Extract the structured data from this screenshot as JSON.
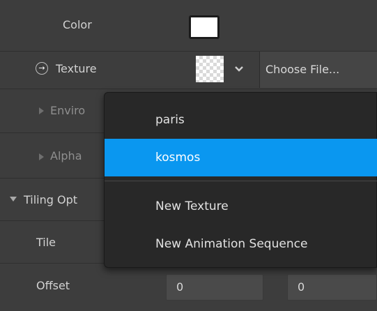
{
  "properties": {
    "color_label": "Color",
    "color_value": "#ffffff",
    "texture_label": "Texture",
    "texture_choose_label": "Choose File...",
    "environment_label": "Enviro",
    "alpha_label": "Alpha",
    "tiling_label": "Tiling Opt",
    "tile_label": "Tile",
    "offset_label": "Offset",
    "offset_x": "0",
    "offset_y": "0"
  },
  "dropdown": {
    "items": [
      {
        "label": "paris",
        "selected": false
      },
      {
        "label": "kosmos",
        "selected": true
      },
      {
        "label": "New Texture",
        "selected": false
      },
      {
        "label": "New Animation Sequence",
        "selected": false
      }
    ]
  },
  "colors": {
    "panel_bg": "#3d3d3d",
    "menu_bg": "#282828",
    "selection_accent": "#0a97f0"
  },
  "icons": [
    "arrow-circle-icon",
    "chevron-down-icon",
    "triangle-right-icon",
    "triangle-down-icon"
  ]
}
